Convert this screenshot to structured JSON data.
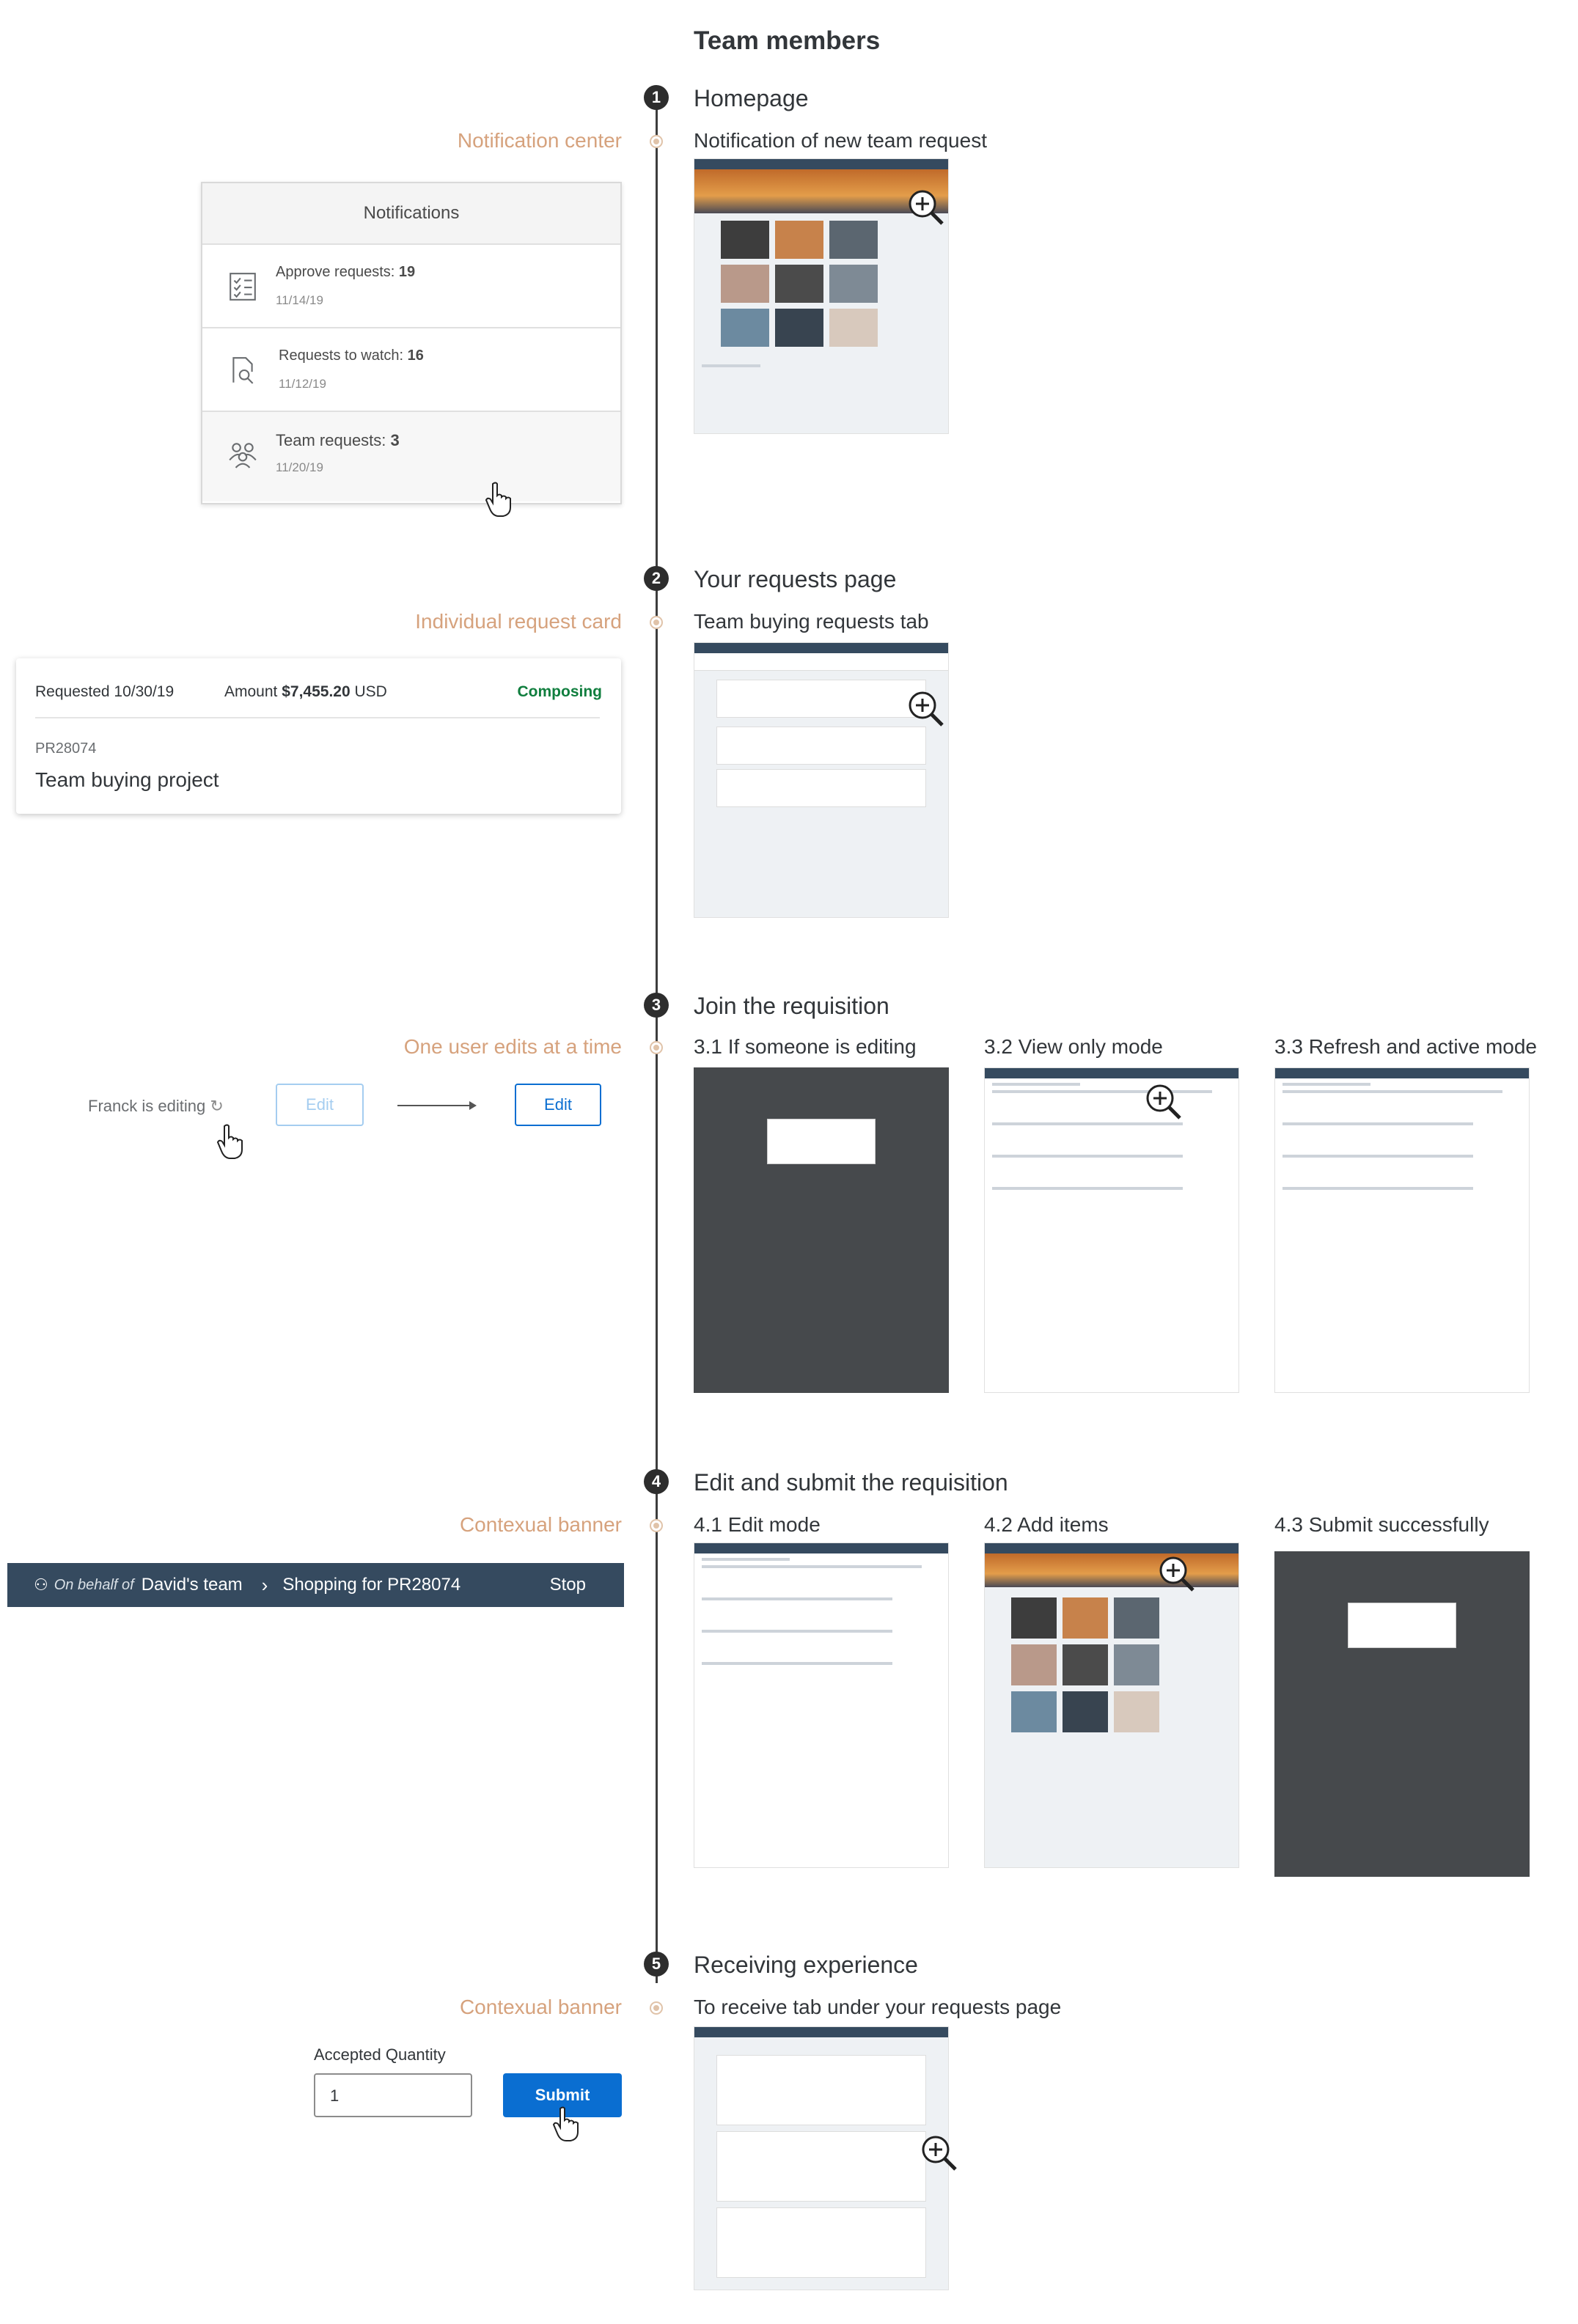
{
  "title": "Team members",
  "steps": [
    {
      "num": "1",
      "heading": "Homepage",
      "sub": "Notification of new team request",
      "left_label": "Notification center"
    },
    {
      "num": "2",
      "heading": "Your requests page",
      "sub": "Team buying requests tab",
      "left_label": "Individual request card"
    },
    {
      "num": "3",
      "heading": "Join the requisition",
      "sub_a": "3.1 If someone is editing",
      "sub_b": "3.2 View only mode",
      "sub_c": "3.3 Refresh and active mode",
      "left_label": "One user edits at a time"
    },
    {
      "num": "4",
      "heading": "Edit and submit the requisition",
      "sub_a": "4.1 Edit mode",
      "sub_b": "4.2 Add items",
      "sub_c": "4.3 Submit successfully",
      "left_label": "Contexual banner"
    },
    {
      "num": "5",
      "heading": "Receiving experience",
      "sub": "To receive tab under your requests page",
      "left_label": "Contexual banner"
    }
  ],
  "notifications": {
    "header": "Notifications",
    "items": [
      {
        "label": "Approve requests: ",
        "count": "19",
        "date": "11/14/19",
        "icon": "checklist-icon"
      },
      {
        "label": "Requests to watch: ",
        "count": "16",
        "date": "11/12/19",
        "icon": "document-search-icon"
      },
      {
        "label": "Team requests: ",
        "count": "3",
        "date": "11/20/19",
        "icon": "team-icon"
      }
    ]
  },
  "request_card": {
    "requested": "Requested 10/30/19",
    "amount_label": "Amount ",
    "amount_value": "$7,455.20",
    "currency": " USD",
    "status": "Composing",
    "id": "PR28074",
    "name": "Team buying project"
  },
  "edit_demo": {
    "editing_text": "Franck is editing",
    "edit_disabled": "Edit",
    "edit_active": "Edit"
  },
  "banner": {
    "on_behalf": "On behalf of",
    "team": "David's team",
    "shopping": "Shopping for PR28074",
    "stop": "Stop"
  },
  "receiving": {
    "qty_label": "Accepted Quantity",
    "qty_value": "1",
    "submit": "Submit"
  },
  "colors": {
    "accent": "#0a6ed1",
    "label": "#d6a27d",
    "status_green": "#107e3e",
    "shell": "#354a5f"
  }
}
